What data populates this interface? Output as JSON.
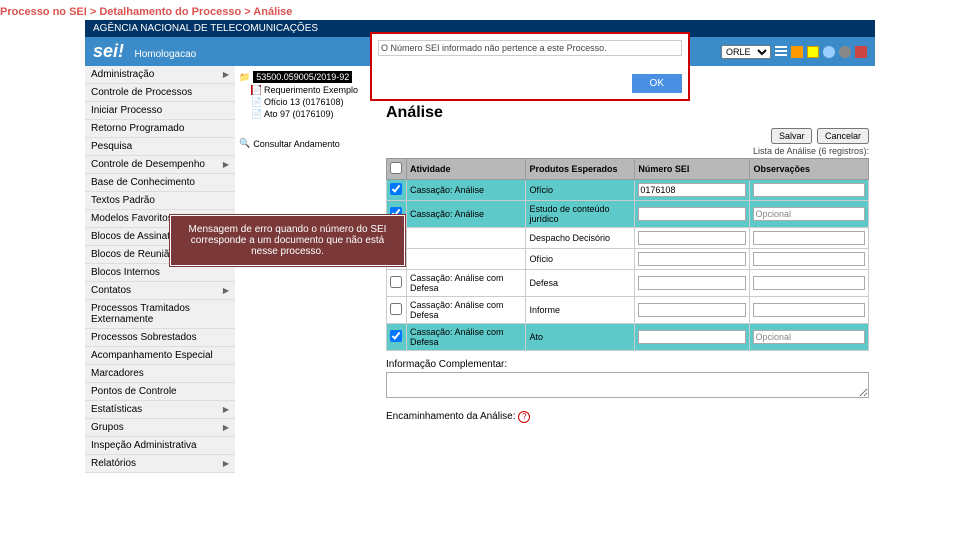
{
  "breadcrumb": "Processo no SEI > Detalhamento do Processo > Análise",
  "topbar": "AGÊNCIA NACIONAL DE TELECOMUNICAÇÕES",
  "logo": "sei!",
  "env": "Homologacao",
  "unit": "ORLE",
  "sidebar": [
    {
      "label": "Administração",
      "sub": true
    },
    {
      "label": "Controle de Processos",
      "sub": false
    },
    {
      "label": "Iniciar Processo",
      "sub": false
    },
    {
      "label": "Retorno Programado",
      "sub": false
    },
    {
      "label": "Pesquisa",
      "sub": false
    },
    {
      "label": "Controle de Desempenho",
      "sub": true
    },
    {
      "label": "Base de Conhecimento",
      "sub": false
    },
    {
      "label": "Textos Padrão",
      "sub": false
    },
    {
      "label": "Modelos Favoritos",
      "sub": false
    },
    {
      "label": "Blocos de Assinatura",
      "sub": false
    },
    {
      "label": "Blocos de Reunião",
      "sub": false
    },
    {
      "label": "Blocos Internos",
      "sub": false
    },
    {
      "label": "Contatos",
      "sub": true
    },
    {
      "label": "Processos Tramitados Externamente",
      "sub": false
    },
    {
      "label": "Processos Sobrestados",
      "sub": false
    },
    {
      "label": "Acompanhamento Especial",
      "sub": false
    },
    {
      "label": "Marcadores",
      "sub": false
    },
    {
      "label": "Pontos de Controle",
      "sub": false
    },
    {
      "label": "Estatísticas",
      "sub": true
    },
    {
      "label": "Grupos",
      "sub": true
    },
    {
      "label": "Inspeção Administrativa",
      "sub": false
    },
    {
      "label": "Relatórios",
      "sub": true
    }
  ],
  "tree": {
    "proc": "53500.059005/2019-92",
    "docs": [
      {
        "t": "pdf",
        "label": "Requerimento Exemplo"
      },
      {
        "t": "doc",
        "label": "Ofício 13 (0176108)"
      },
      {
        "t": "doc",
        "label": "Ato 97 (0176109)"
      }
    ],
    "consult": "Consultar Andamento"
  },
  "dialog": {
    "msg": "O Número SEI informado não pertence a este Processo.",
    "ok": "OK"
  },
  "callout": "Mensagem de erro quando o número do SEI corresponde a um documento que não está nesse processo.",
  "page": {
    "title": "Análise",
    "save": "Salvar",
    "cancel": "Cancelar",
    "listinfo": "Lista de Análise (6 registros):",
    "cols": {
      "c0": "",
      "c1": "Atividade",
      "c2": "Produtos Esperados",
      "c3": "Número SEI",
      "c4": "Observações"
    },
    "rows": [
      {
        "hl": true,
        "chk": true,
        "a": "Cassação: Análise",
        "p": "Ofício",
        "n": "0176108",
        "o": ""
      },
      {
        "hl": true,
        "chk": true,
        "a": "Cassação: Análise",
        "p": "Estudo de conteúdo jurídico",
        "n": "",
        "o": "Opcional"
      },
      {
        "hl": false,
        "chk": false,
        "a": "",
        "p": "Despacho Decisório",
        "n": "",
        "o": ""
      },
      {
        "hl": false,
        "chk": false,
        "a": "",
        "p": "Ofício",
        "n": "",
        "o": ""
      },
      {
        "hl": false,
        "chk": false,
        "a": "Cassação: Análise com Defesa",
        "p": "Defesa",
        "n": "",
        "o": ""
      },
      {
        "hl": false,
        "chk": false,
        "a": "Cassação: Análise com Defesa",
        "p": "Informe",
        "n": "",
        "o": ""
      },
      {
        "hl": true,
        "chk": true,
        "a": "Cassação: Análise com Defesa",
        "p": "Ato",
        "n": "",
        "o": "Opcional"
      }
    ],
    "info_lbl": "Informação Complementar:",
    "enc_lbl": "Encaminhamento da Análise:"
  }
}
